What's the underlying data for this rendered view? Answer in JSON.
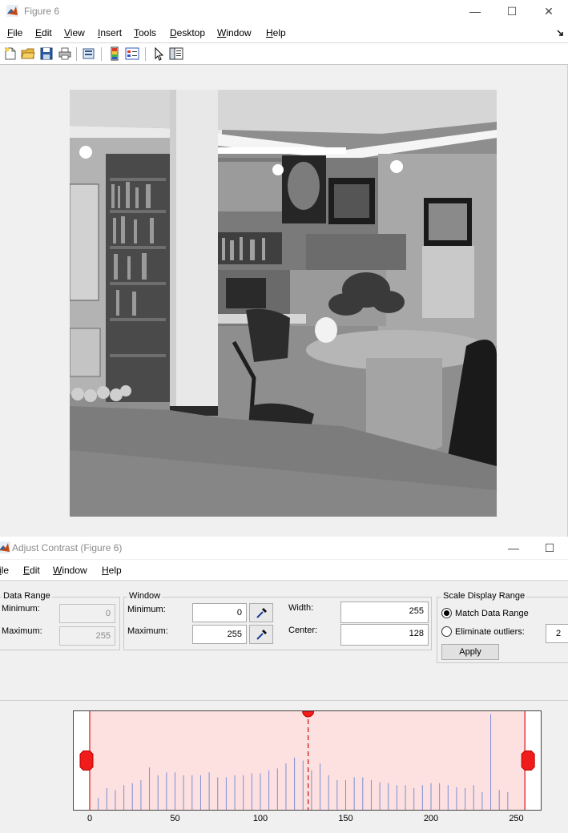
{
  "figure_window": {
    "title": "Figure 6",
    "controls": [
      "—",
      "☐",
      "✕"
    ],
    "menu": [
      "File",
      "Edit",
      "View",
      "Insert",
      "Tools",
      "Desktop",
      "Window",
      "Help"
    ],
    "toolbar_icons": [
      "new-figure-icon",
      "open-file-icon",
      "save-icon",
      "print-icon",
      "print-preview-icon",
      "colorbar-icon",
      "legend-icon",
      "pointer-icon",
      "property-inspector-icon"
    ]
  },
  "adjust_window": {
    "title": "Adjust Contrast (Figure 6)",
    "controls": [
      "—",
      "☐"
    ],
    "menu": [
      "ile",
      "Edit",
      "Window",
      "Help"
    ],
    "data_range": {
      "title": "Data Range",
      "min_label": "Minimum:",
      "min_value": "0",
      "max_label": "Maximum:",
      "max_value": "255"
    },
    "window": {
      "title": "Window",
      "min_label": "Minimum:",
      "min_value": "0",
      "max_label": "Maximum:",
      "max_value": "255",
      "width_label": "Width:",
      "width_value": "255",
      "center_label": "Center:",
      "center_value": "128"
    },
    "scale": {
      "title": "Scale Display Range",
      "match_label": "Match Data Range",
      "match_selected": true,
      "outliers_label": "Eliminate outliers:",
      "outliers_value": "2",
      "apply_label": "Apply"
    }
  },
  "chart_data": {
    "type": "bar",
    "title": "",
    "xlabel": "",
    "ylabel": "",
    "xlim": [
      0,
      260
    ],
    "ylim": [
      0,
      1
    ],
    "xticks": [
      "0",
      "50",
      "100",
      "150",
      "200",
      "250"
    ],
    "window_min": 0,
    "window_max": 255,
    "window_center": 128,
    "x": [
      5,
      10,
      15,
      20,
      25,
      30,
      35,
      40,
      45,
      50,
      55,
      60,
      65,
      70,
      75,
      80,
      85,
      90,
      95,
      100,
      105,
      110,
      115,
      120,
      125,
      130,
      135,
      140,
      145,
      150,
      155,
      160,
      165,
      170,
      175,
      180,
      185,
      190,
      195,
      200,
      205,
      210,
      215,
      220,
      225,
      230,
      235,
      240,
      245
    ],
    "values": [
      0.12,
      0.22,
      0.2,
      0.25,
      0.27,
      0.3,
      0.43,
      0.35,
      0.38,
      0.38,
      0.35,
      0.35,
      0.35,
      0.38,
      0.33,
      0.33,
      0.35,
      0.35,
      0.37,
      0.37,
      0.4,
      0.42,
      0.47,
      0.53,
      0.5,
      0.4,
      0.47,
      0.35,
      0.3,
      0.3,
      0.33,
      0.33,
      0.3,
      0.28,
      0.27,
      0.25,
      0.25,
      0.22,
      0.25,
      0.27,
      0.27,
      0.25,
      0.23,
      0.22,
      0.25,
      0.18,
      0.97,
      0.2,
      0.18
    ]
  }
}
